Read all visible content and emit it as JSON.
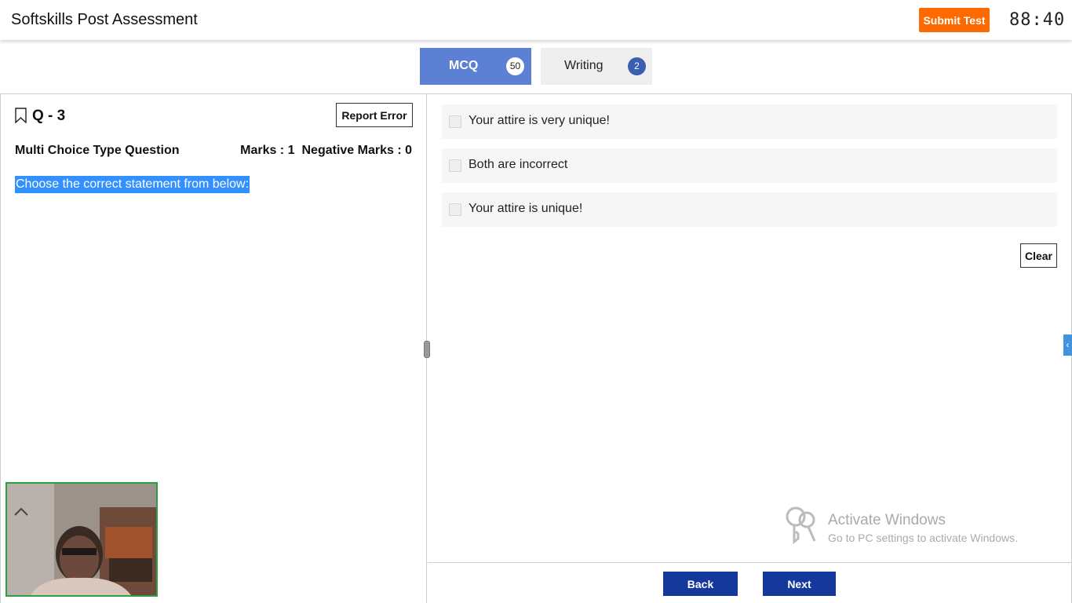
{
  "header": {
    "title": "Softskills Post Assessment",
    "submit_label": "Submit Test",
    "timer": "88:40"
  },
  "tabs": [
    {
      "label": "MCQ",
      "count": "50",
      "active": true
    },
    {
      "label": "Writing",
      "count": "2",
      "active": false
    }
  ],
  "question": {
    "number": "Q - 3",
    "report_label": "Report Error",
    "type": "Multi Choice Type Question",
    "marks": "Marks : 1",
    "negative_marks": "Negative Marks : 0",
    "text": "Choose the correct statement from below:"
  },
  "options": [
    {
      "label": "Your attire is very unique!",
      "checked": false
    },
    {
      "label": "Both are incorrect",
      "checked": false
    },
    {
      "label": "Your attire is unique!",
      "checked": false
    }
  ],
  "clear_label": "Clear",
  "watermark": {
    "title": "Activate Windows",
    "subtitle": "Go to PC settings to activate Windows."
  },
  "footer": {
    "back_label": "Back",
    "next_label": "Next"
  },
  "colors": {
    "accent_orange": "#ff6a00",
    "tab_active": "#5b80d4",
    "nav_button": "#14389c",
    "selection": "#3390ff"
  }
}
